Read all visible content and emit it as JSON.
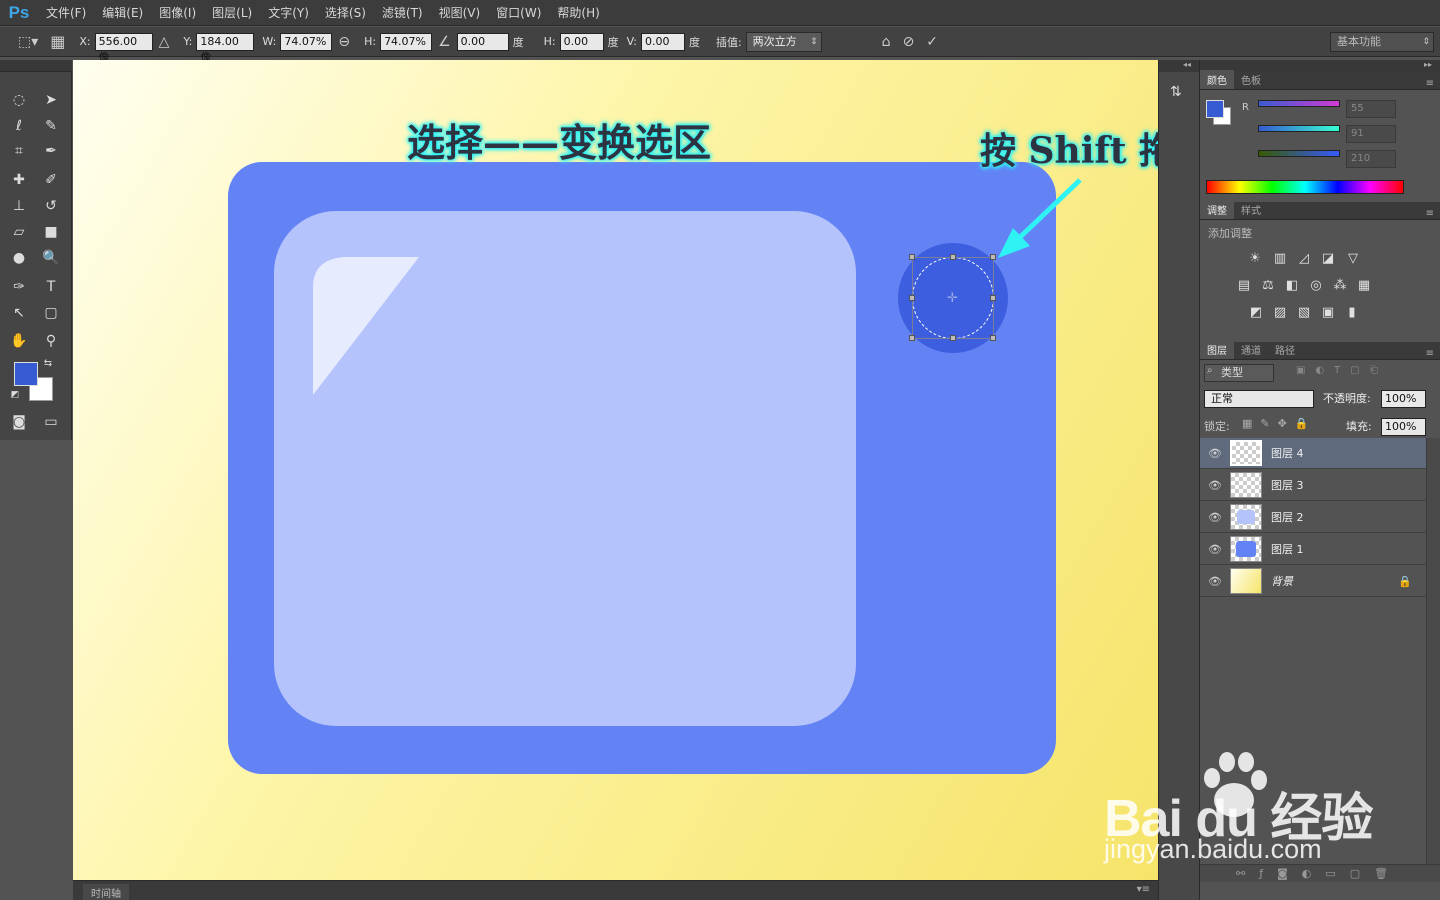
{
  "app": {
    "logo": "Ps"
  },
  "menu": [
    "文件(F)",
    "编辑(E)",
    "图像(I)",
    "图层(L)",
    "文字(Y)",
    "选择(S)",
    "滤镜(T)",
    "视图(V)",
    "窗口(W)",
    "帮助(H)"
  ],
  "options": {
    "x_label": "X:",
    "x_value": "556.00 像",
    "y_label": "Y:",
    "y_value": "184.00 像",
    "w_label": "W:",
    "w_value": "74.07%",
    "h_label": "H:",
    "h_value": "74.07%",
    "angle_value": "0.00",
    "angle_unit": "度",
    "hskew_label": "H:",
    "hskew_value": "0.00",
    "hskew_unit": "度",
    "vskew_label": "V:",
    "vskew_value": "0.00",
    "vskew_unit": "度",
    "interp_label": "插值:",
    "interp_value": "两次立方",
    "workspace": "基本功能"
  },
  "canvas": {
    "annotation_left": "选择——变换选区",
    "annotation_right": "按 Shift 拖动此处"
  },
  "timeline": {
    "tab": "时间轴"
  },
  "color_panel": {
    "tabs": [
      "颜色",
      "色板"
    ],
    "r_label": "R",
    "values": [
      "55",
      "91",
      "210"
    ],
    "fg_color": "#375bd2",
    "bg_color": "#ffffff"
  },
  "adjust_panel": {
    "tabs": [
      "调整",
      "样式"
    ],
    "hint": "添加调整"
  },
  "layers_panel": {
    "tabs": [
      "图层",
      "通道",
      "路径"
    ],
    "filter_label": "类型",
    "blend_mode": "正常",
    "opacity_label": "不透明度:",
    "opacity_value": "100%",
    "lock_label": "锁定:",
    "fill_label": "填充:",
    "fill_value": "100%",
    "layers": [
      {
        "name": "图层 4",
        "selected": true
      },
      {
        "name": "图层 3",
        "selected": false
      },
      {
        "name": "图层 2",
        "selected": false
      },
      {
        "name": "图层 1",
        "selected": false
      },
      {
        "name": "背景",
        "selected": false,
        "locked": true
      }
    ]
  },
  "watermark": {
    "brand": "Bai  du 经验",
    "url": "jingyan.baidu.com"
  },
  "colors": {
    "outer": "#6383f5",
    "inner": "#b4c3fc",
    "circle": "#3d5fdf",
    "arrow": "#2ff2f5",
    "canvas_bg": "#f6e46a"
  }
}
